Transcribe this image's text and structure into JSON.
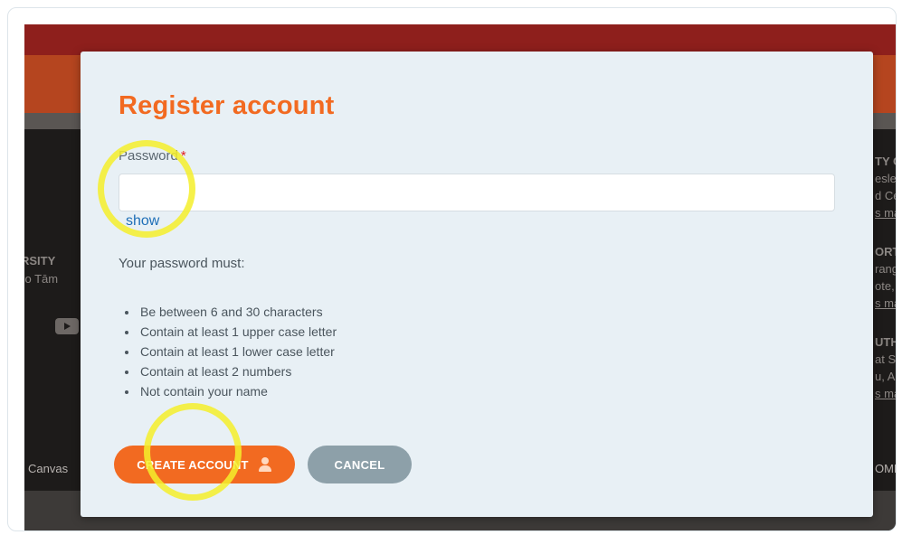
{
  "background": {
    "left_fragments": [
      "RSITY ",
      "i o Tām"
    ],
    "right_fragments": [
      "TY C",
      "esley",
      "d Ce",
      "s map",
      "ORTH",
      "ranga",
      "ote, A",
      "s map",
      "UTH",
      "at Sc",
      "u, Au",
      "s map"
    ],
    "footer_left": "Canvas",
    "footer_right": "OMPLI"
  },
  "modal": {
    "title": "Register account",
    "password_label": "Password",
    "required_marker": "*",
    "password_value": "",
    "show_link": "show",
    "rules_heading": "Your password must:",
    "rules": [
      "Be between 6 and 30 characters",
      "Contain at least 1 upper case letter",
      "Contain at least 1 lower case letter",
      "Contain at least 2 numbers",
      "Not contain your name"
    ],
    "create_button": "CREATE ACCOUNT",
    "cancel_button": "CANCEL"
  },
  "colors": {
    "accent": "#f26a21",
    "cancel": "#8da0a9",
    "highlight": "#f5ee2a",
    "link": "#1f6fb7"
  },
  "icons": {
    "create_button_icon": "user-icon",
    "background_icon": "youtube-icon"
  }
}
